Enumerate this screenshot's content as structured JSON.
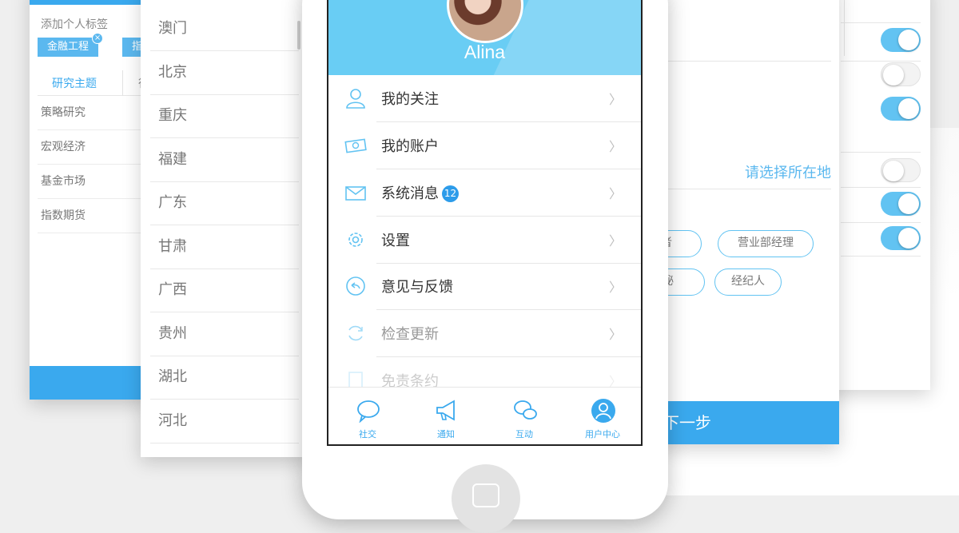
{
  "colors": {
    "accent": "#3aa9ee",
    "header": "#69cdf4",
    "toggle_on": "#62c3f2"
  },
  "tag_panel": {
    "title": "添加个人标签",
    "tags": [
      "金融工程",
      "指"
    ],
    "tabs": [
      "研究主题",
      "行"
    ],
    "items": [
      "策略研究",
      "宏观经济",
      "基金市场",
      "指数期货"
    ]
  },
  "province_panel": {
    "items": [
      "澳门",
      "北京",
      "重庆",
      "福建",
      "广东",
      "甘肃",
      "广西",
      "贵州",
      "湖北",
      "河北"
    ]
  },
  "settings_panel": {
    "toggles": [
      true,
      false,
      true,
      false,
      true,
      true
    ],
    "region_placeholder": "请选择所在地",
    "roles": [
      "者",
      "营业部经理",
      "秘",
      "经纪人"
    ],
    "next_button": "下一步"
  },
  "phone": {
    "user_name": "Alina",
    "menu": [
      {
        "label": "我的关注",
        "icon": "user-icon"
      },
      {
        "label": "我的账户",
        "icon": "money-icon"
      },
      {
        "label": "系统消息",
        "icon": "mail-icon",
        "badge": "12"
      },
      {
        "label": "设置",
        "icon": "gear-icon"
      },
      {
        "label": "意见与反馈",
        "icon": "feedback-icon"
      },
      {
        "label": "检查更新",
        "icon": "refresh-icon"
      },
      {
        "label": "免责条约",
        "icon": "document-icon"
      }
    ],
    "tabs": [
      {
        "label": "社交",
        "icon": "chat-bubble-icon"
      },
      {
        "label": "通知",
        "icon": "megaphone-icon"
      },
      {
        "label": "互动",
        "icon": "chats-icon"
      },
      {
        "label": "用户中心",
        "icon": "user-center-icon"
      }
    ]
  }
}
